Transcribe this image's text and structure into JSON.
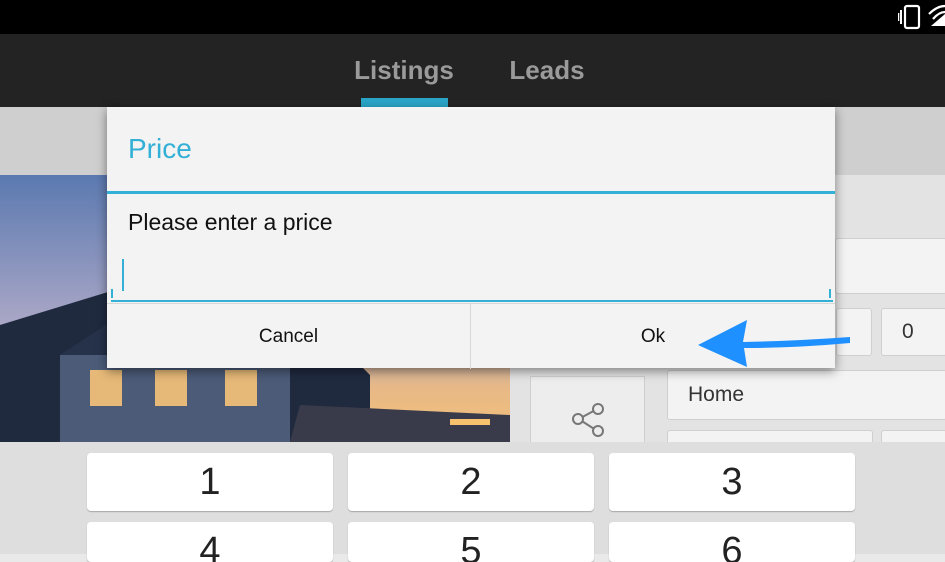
{
  "tabs": [
    {
      "label": "Listings",
      "active": true
    },
    {
      "label": "Leads",
      "active": false
    }
  ],
  "dialog": {
    "title": "Price",
    "message": "Please enter a price",
    "input_value": "",
    "cancel_label": "Cancel",
    "ok_label": "Ok"
  },
  "background": {
    "zero_field_value": "0",
    "home_field_value": "Home"
  },
  "keyboard": {
    "keys_row1": [
      "1",
      "2",
      "3"
    ],
    "keys_row2": [
      "4",
      "5",
      "6"
    ]
  },
  "icons": [
    "vibrate-icon",
    "wifi-icon",
    "share-icon",
    "arrow-annotation-icon"
  ],
  "colors": {
    "accent": "#33b0d6",
    "annotation_arrow": "#1e90ff"
  }
}
